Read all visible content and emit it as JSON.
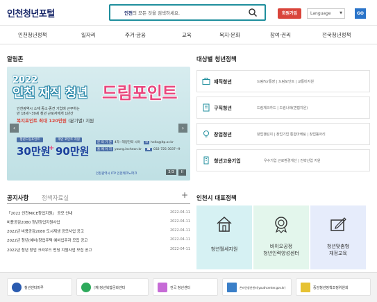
{
  "header": {
    "logo": "인천청년포털",
    "search_highlight": "인천",
    "search_placeholder": "의 모든 것을 검색하세요.",
    "join_label": "회원가입",
    "language_label": "Language",
    "go_label": "GO"
  },
  "nav": {
    "items": [
      "인천청년정책",
      "일자리",
      "주거·금융",
      "교육",
      "복지·문화",
      "참여·권리",
      "전국청년정책"
    ]
  },
  "alarm": {
    "title": "알림존",
    "banner": {
      "year": "2022",
      "title_a": "인천 재직 청년",
      "title_b": "드림포인트",
      "desc1": "인천광역시 소재 중소·중견 기업에 근무하는",
      "desc2": "만 18세~39세 청년 근로자에게 1년간",
      "highlight": "복지포인트 최대 120만원",
      "highlight_note": "(분기별) 지원",
      "chip1": "청년드림포인트",
      "chip2": "개인 포인트 지원",
      "amount1": "30만원",
      "amount2": "90만원",
      "tag1": "문 의 기 관",
      "info1": "4차~해양전략 시야",
      "info1b": "hello@itp.or.kr",
      "tag2": "홈 페 이 지",
      "info2": "young.incheon.kr",
      "info2b": "032-725-3037~9",
      "org": "인천광역시  ITP 인천테크노파크",
      "counter": "3/3",
      "pause": "II"
    }
  },
  "targets": {
    "title": "대상별 청년정책",
    "items": [
      {
        "label": "재직청년",
        "sub": "드림For통장 | 드림포인트 | 교통비지원"
      },
      {
        "label": "구직청년",
        "sub": "드림체크카드 | 드림나래(면접지원)"
      },
      {
        "label": "창업청년",
        "sub": "창업챌린지 | 창업기업 통합마케팅 | 창업동아리"
      },
      {
        "label": "청년고용기업",
        "sub": "우수기업 근로환경개선 | 전략산업 지원"
      }
    ]
  },
  "notices": {
    "tab_active": "공지사항",
    "tab_inactive": "정책자료실",
    "plus": "+",
    "items": [
      {
        "title": "「2022 인천MICE창업지원」 공모 안내",
        "date": "2022-04-11"
      },
      {
        "title": "비용공감2080 청년창업지원사업",
        "date": "2022-04-11"
      },
      {
        "title": "2022년 비용공감2080 도시재생 공모사업 공고",
        "date": "2022-04-11"
      },
      {
        "title": "2022년 청년(예비)창업주택 예비입주자 모집 공고",
        "date": "2022-04-11"
      },
      {
        "title": "2022년 청년 창업 크라우드 펀딩 지원사업 모집 공고",
        "date": "2022-04-11"
      }
    ]
  },
  "representative": {
    "title": "인천시 대표정책",
    "items": [
      {
        "label1": "청년월세지원",
        "label2": ""
      },
      {
        "label1": "바이오공정",
        "label2": "청년인력양성센터"
      },
      {
        "label1": "청년맞춤형",
        "label2": "재정교육"
      }
    ]
  },
  "bottom": {
    "items": [
      {
        "label": "청년센터마루"
      },
      {
        "label": "(재)청년복합문화센터"
      },
      {
        "label": "전국 청년센터"
      },
      {
        "label": "온라인청년센터(youthcenter.gov.kr)"
      },
      {
        "label": "중앙청년정책조정위원회"
      }
    ]
  },
  "colors": {
    "accent": "#1e8e9c",
    "brand": "#1b2a6b",
    "join": "#d9453b",
    "go": "#2a74c9",
    "rep_bg1": "#d6f1f3",
    "rep_bg2": "#e3f6ec",
    "rep_bg3": "#e6ecfb"
  }
}
